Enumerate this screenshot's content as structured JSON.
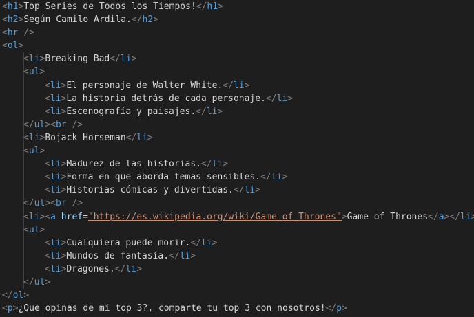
{
  "colors": {
    "background": "#1e1e1e",
    "tag": "#569cd6",
    "punctuation": "#808080",
    "attribute": "#9cdcfe",
    "string": "#ce9178",
    "text": "#d4d4d4",
    "indent_guide": "#404040"
  },
  "lines": [
    {
      "indent": 0,
      "tokens": [
        [
          "p",
          "<"
        ],
        [
          "t",
          "h1"
        ],
        [
          "p",
          ">"
        ],
        [
          "x",
          "Top Series de Todos los Tiempos!"
        ],
        [
          "p",
          "</"
        ],
        [
          "t",
          "h1"
        ],
        [
          "p",
          ">"
        ]
      ]
    },
    {
      "indent": 0,
      "tokens": [
        [
          "p",
          "<"
        ],
        [
          "t",
          "h2"
        ],
        [
          "p",
          ">"
        ],
        [
          "x",
          "Según Camilo Ardila."
        ],
        [
          "p",
          "</"
        ],
        [
          "t",
          "h2"
        ],
        [
          "p",
          ">"
        ]
      ]
    },
    {
      "indent": 0,
      "tokens": [
        [
          "p",
          "<"
        ],
        [
          "t",
          "hr"
        ],
        [
          "x",
          " "
        ],
        [
          "p",
          "/>"
        ]
      ]
    },
    {
      "indent": 0,
      "tokens": [
        [
          "p",
          "<"
        ],
        [
          "t",
          "ol"
        ],
        [
          "p",
          ">"
        ]
      ]
    },
    {
      "indent": 1,
      "tokens": [
        [
          "p",
          "<"
        ],
        [
          "t",
          "li"
        ],
        [
          "p",
          ">"
        ],
        [
          "x",
          "Breaking Bad"
        ],
        [
          "p",
          "</"
        ],
        [
          "t",
          "li"
        ],
        [
          "p",
          ">"
        ]
      ]
    },
    {
      "indent": 1,
      "tokens": [
        [
          "p",
          "<"
        ],
        [
          "t",
          "ul"
        ],
        [
          "p",
          ">"
        ]
      ]
    },
    {
      "indent": 2,
      "tokens": [
        [
          "p",
          "<"
        ],
        [
          "t",
          "li"
        ],
        [
          "p",
          ">"
        ],
        [
          "x",
          "El personaje de Walter White."
        ],
        [
          "p",
          "</"
        ],
        [
          "t",
          "li"
        ],
        [
          "p",
          ">"
        ]
      ]
    },
    {
      "indent": 2,
      "tokens": [
        [
          "p",
          "<"
        ],
        [
          "t",
          "li"
        ],
        [
          "p",
          ">"
        ],
        [
          "x",
          "La historia detrás de cada personaje."
        ],
        [
          "p",
          "</"
        ],
        [
          "t",
          "li"
        ],
        [
          "p",
          ">"
        ]
      ]
    },
    {
      "indent": 2,
      "tokens": [
        [
          "p",
          "<"
        ],
        [
          "t",
          "li"
        ],
        [
          "p",
          ">"
        ],
        [
          "x",
          "Escenografía y paisajes."
        ],
        [
          "p",
          "</"
        ],
        [
          "t",
          "li"
        ],
        [
          "p",
          ">"
        ]
      ]
    },
    {
      "indent": 1,
      "tokens": [
        [
          "p",
          "</"
        ],
        [
          "t",
          "ul"
        ],
        [
          "p",
          ">"
        ],
        [
          "p",
          "<"
        ],
        [
          "t",
          "br"
        ],
        [
          "x",
          " "
        ],
        [
          "p",
          "/>"
        ]
      ]
    },
    {
      "indent": 1,
      "tokens": [
        [
          "p",
          "<"
        ],
        [
          "t",
          "li"
        ],
        [
          "p",
          ">"
        ],
        [
          "x",
          "Bojack Horseman"
        ],
        [
          "p",
          "</"
        ],
        [
          "t",
          "li"
        ],
        [
          "p",
          ">"
        ]
      ]
    },
    {
      "indent": 1,
      "tokens": [
        [
          "p",
          "<"
        ],
        [
          "t",
          "ul"
        ],
        [
          "p",
          ">"
        ]
      ]
    },
    {
      "indent": 2,
      "tokens": [
        [
          "p",
          "<"
        ],
        [
          "t",
          "li"
        ],
        [
          "p",
          ">"
        ],
        [
          "x",
          "Madurez de las historias."
        ],
        [
          "p",
          "</"
        ],
        [
          "t",
          "li"
        ],
        [
          "p",
          ">"
        ]
      ]
    },
    {
      "indent": 2,
      "tokens": [
        [
          "p",
          "<"
        ],
        [
          "t",
          "li"
        ],
        [
          "p",
          ">"
        ],
        [
          "x",
          "Forma en que aborda temas sensibles."
        ],
        [
          "p",
          "</"
        ],
        [
          "t",
          "li"
        ],
        [
          "p",
          ">"
        ]
      ]
    },
    {
      "indent": 2,
      "tokens": [
        [
          "p",
          "<"
        ],
        [
          "t",
          "li"
        ],
        [
          "p",
          ">"
        ],
        [
          "x",
          "Historias cómicas y divertidas."
        ],
        [
          "p",
          "</"
        ],
        [
          "t",
          "li"
        ],
        [
          "p",
          ">"
        ]
      ]
    },
    {
      "indent": 1,
      "tokens": [
        [
          "p",
          "</"
        ],
        [
          "t",
          "ul"
        ],
        [
          "p",
          ">"
        ],
        [
          "p",
          "<"
        ],
        [
          "t",
          "br"
        ],
        [
          "x",
          " "
        ],
        [
          "p",
          "/>"
        ]
      ]
    },
    {
      "indent": 1,
      "tokens": [
        [
          "p",
          "<"
        ],
        [
          "t",
          "li"
        ],
        [
          "p",
          ">"
        ],
        [
          "p",
          "<"
        ],
        [
          "t",
          "a"
        ],
        [
          "x",
          " "
        ],
        [
          "a",
          "href"
        ],
        [
          "x",
          "="
        ],
        [
          "s",
          "\"https://es.wikipedia.org/wiki/Game_of_Thrones\""
        ],
        [
          "p",
          ">"
        ],
        [
          "x",
          "Game of Thrones"
        ],
        [
          "p",
          "</"
        ],
        [
          "t",
          "a"
        ],
        [
          "p",
          ">"
        ],
        [
          "p",
          "</"
        ],
        [
          "t",
          "li"
        ],
        [
          "p",
          ">"
        ]
      ]
    },
    {
      "indent": 1,
      "tokens": [
        [
          "p",
          "<"
        ],
        [
          "t",
          "ul"
        ],
        [
          "p",
          ">"
        ]
      ]
    },
    {
      "indent": 2,
      "tokens": [
        [
          "p",
          "<"
        ],
        [
          "t",
          "li"
        ],
        [
          "p",
          ">"
        ],
        [
          "x",
          "Cualquiera puede morir."
        ],
        [
          "p",
          "</"
        ],
        [
          "t",
          "li"
        ],
        [
          "p",
          ">"
        ]
      ]
    },
    {
      "indent": 2,
      "tokens": [
        [
          "p",
          "<"
        ],
        [
          "t",
          "li"
        ],
        [
          "p",
          ">"
        ],
        [
          "x",
          "Mundos de fantasía."
        ],
        [
          "p",
          "</"
        ],
        [
          "t",
          "li"
        ],
        [
          "p",
          ">"
        ]
      ]
    },
    {
      "indent": 2,
      "tokens": [
        [
          "p",
          "<"
        ],
        [
          "t",
          "li"
        ],
        [
          "p",
          ">"
        ],
        [
          "x",
          "Dragones."
        ],
        [
          "p",
          "</"
        ],
        [
          "t",
          "li"
        ],
        [
          "p",
          ">"
        ]
      ]
    },
    {
      "indent": 1,
      "tokens": [
        [
          "p",
          "</"
        ],
        [
          "t",
          "ul"
        ],
        [
          "p",
          ">"
        ]
      ]
    },
    {
      "indent": 0,
      "tokens": [
        [
          "p",
          "</"
        ],
        [
          "t",
          "ol"
        ],
        [
          "p",
          ">"
        ]
      ]
    },
    {
      "indent": 0,
      "tokens": [
        [
          "p",
          "<"
        ],
        [
          "t",
          "p"
        ],
        [
          "p",
          ">"
        ],
        [
          "x",
          "¿Que opinas de mi top 3?, comparte tu top 3 con nosotros!"
        ],
        [
          "p",
          "</"
        ],
        [
          "t",
          "p"
        ],
        [
          "p",
          ">"
        ]
      ]
    }
  ]
}
